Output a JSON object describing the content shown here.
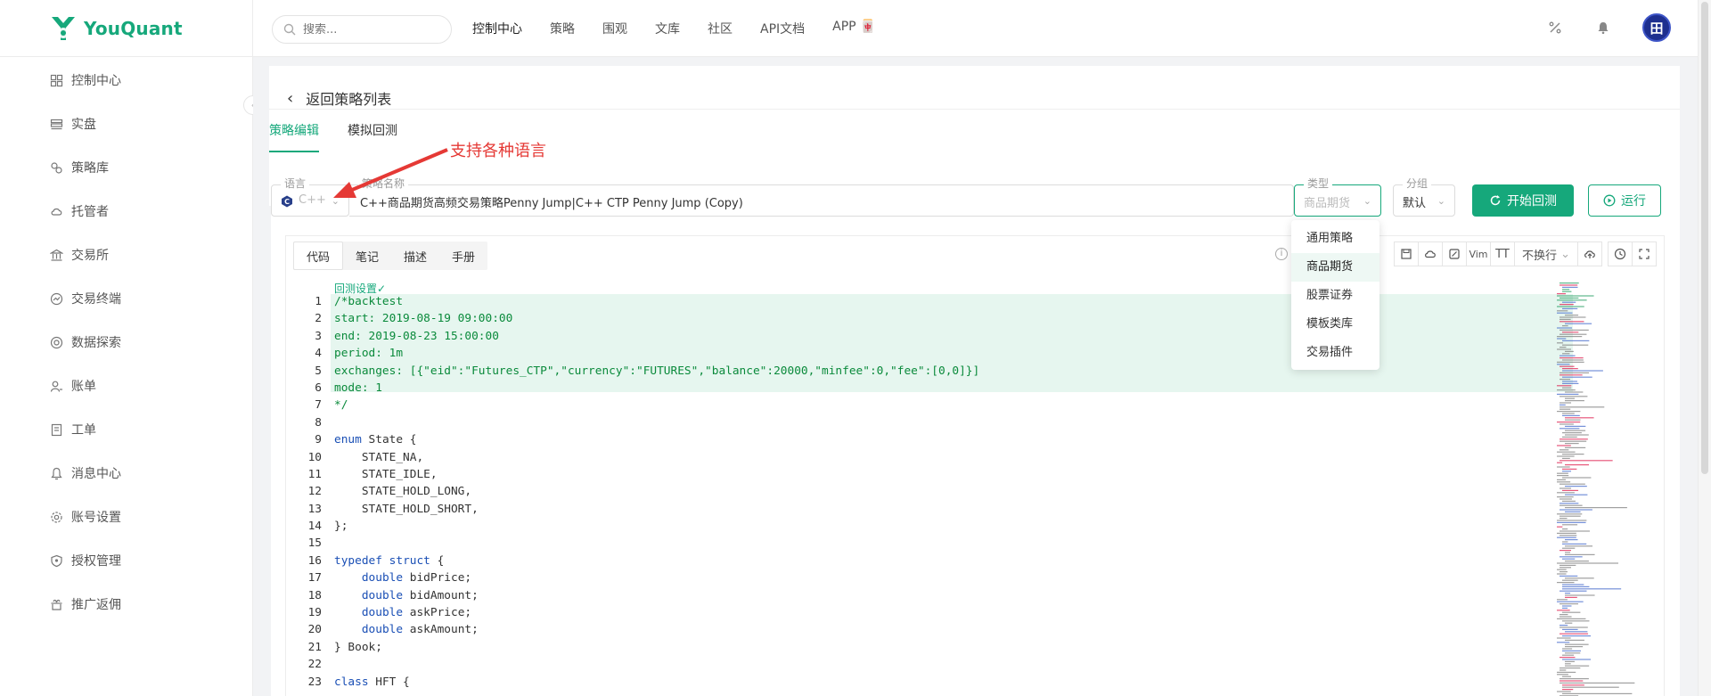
{
  "brand": {
    "name": "YouQuant"
  },
  "search": {
    "placeholder": "搜索..."
  },
  "topnav": [
    "控制中心",
    "策略",
    "围观",
    "文库",
    "社区",
    "API文档",
    "APP 🀄"
  ],
  "user": {
    "avatar_text": "田"
  },
  "sidebar": {
    "items": [
      {
        "label": "控制中心",
        "icon": "dashboard-icon"
      },
      {
        "label": "实盘",
        "icon": "server-icon"
      },
      {
        "label": "策略库",
        "icon": "strategy-icon"
      },
      {
        "label": "托管者",
        "icon": "cloud-icon"
      },
      {
        "label": "交易所",
        "icon": "bank-icon"
      },
      {
        "label": "交易终端",
        "icon": "terminal-icon"
      },
      {
        "label": "数据探索",
        "icon": "data-icon"
      },
      {
        "label": "账单",
        "icon": "bill-icon"
      },
      {
        "label": "工单",
        "icon": "ticket-icon"
      },
      {
        "label": "消息中心",
        "icon": "bell-icon"
      },
      {
        "label": "账号设置",
        "icon": "gear-icon"
      },
      {
        "label": "授权管理",
        "icon": "shield-icon"
      },
      {
        "label": "推广返佣",
        "icon": "gift-icon"
      }
    ]
  },
  "page": {
    "back_label": "返回策略列表",
    "tabs": [
      "策略编辑",
      "模拟回测"
    ]
  },
  "annotation": {
    "text": "支持各种语言"
  },
  "form": {
    "language": {
      "label": "语言",
      "value": "C++"
    },
    "name": {
      "label": "策略名称",
      "value": "C++商品期货高频交易策略Penny Jump|C++ CTP Penny Jump (Copy)"
    },
    "type": {
      "label": "类型",
      "value": "商品期货"
    },
    "group": {
      "label": "分组",
      "value": "默认"
    },
    "backtest_button": "开始回测",
    "run_button": "运行"
  },
  "type_dropdown": {
    "options": [
      "通用策略",
      "商品期货",
      "股票证券",
      "模板类库",
      "交易插件"
    ],
    "selected": "商品期货"
  },
  "editor": {
    "tabs": [
      "代码",
      "笔记",
      "描述",
      "手册"
    ],
    "wrap_label": "不换行",
    "vim_label": "Vim",
    "font_label": "TT",
    "code_lens": "回测设置✓",
    "lines": [
      "/*backtest",
      "start: 2019-08-19 09:00:00",
      "end: 2019-08-23 15:00:00",
      "period: 1m",
      "exchanges: [{\"eid\":\"Futures_CTP\",\"currency\":\"FUTURES\",\"balance\":20000,\"minfee\":0,\"fee\":[0,0]}]",
      "mode: 1",
      "*/",
      "",
      "enum State {",
      "    STATE_NA,",
      "    STATE_IDLE,",
      "    STATE_HOLD_LONG,",
      "    STATE_HOLD_SHORT,",
      "};",
      "",
      "typedef struct {",
      "    double bidPrice;",
      "    double bidAmount;",
      "    double askPrice;",
      "    double askAmount;",
      "} Book;",
      "",
      "class HFT {"
    ]
  }
}
